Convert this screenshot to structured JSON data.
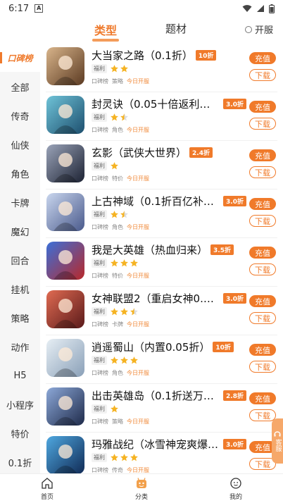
{
  "status_bar": {
    "time": "6:17",
    "sim_label": "A"
  },
  "top_tabs": [
    {
      "label": "类型",
      "active": true
    },
    {
      "label": "题材",
      "active": false
    }
  ],
  "kaifu_toggle": {
    "label": "开服"
  },
  "sidebar": {
    "items": [
      {
        "label": "口碑榜",
        "active": true
      },
      {
        "label": "全部"
      },
      {
        "label": "传奇"
      },
      {
        "label": "仙侠"
      },
      {
        "label": "角色"
      },
      {
        "label": "卡牌"
      },
      {
        "label": "魔幻"
      },
      {
        "label": "回合"
      },
      {
        "label": "挂机"
      },
      {
        "label": "策略"
      },
      {
        "label": "动作"
      },
      {
        "label": "H5"
      },
      {
        "label": "小程序"
      },
      {
        "label": "特价"
      },
      {
        "label": "0.1折"
      }
    ]
  },
  "games": [
    {
      "name": "大当家之路（0.1折）",
      "discount": "10折",
      "fuli": "福利",
      "rating": 2,
      "tags": [
        "口碑榜",
        "策略"
      ],
      "open": "今日开服",
      "icon_colors": [
        "#d8b48a",
        "#5b3a22"
      ]
    },
    {
      "name": "封灵诀（0.05十倍返利免单…",
      "discount": "3.0折",
      "fuli": "福利",
      "rating": 1.5,
      "tags": [
        "口碑榜",
        "角色"
      ],
      "open": "今日开服",
      "icon_colors": [
        "#6fc3d8",
        "#1d4f6e"
      ]
    },
    {
      "name": "玄影（武侠大世界）",
      "discount": "2.4折",
      "fuli": "福利",
      "rating": 1,
      "tags": [
        "口碑榜",
        "特价"
      ],
      "open": "今日开服",
      "icon_colors": [
        "#9aa3b8",
        "#1c2233"
      ]
    },
    {
      "name": "上古神域（0.1折百亿补贴）",
      "discount": "3.0折",
      "fuli": "福利",
      "rating": 1.5,
      "tags": [
        "口碑榜",
        "角色"
      ],
      "open": "今日开服",
      "icon_colors": [
        "#c9d6ee",
        "#4a5a8c"
      ]
    },
    {
      "name": "我是大英雄（热血归来）",
      "discount": "3.5折",
      "fuli": "福利",
      "rating": 3,
      "tags": [
        "口碑榜",
        "特价"
      ],
      "open": "今日开服",
      "icon_colors": [
        "#3b6fd8",
        "#b8282a"
      ]
    },
    {
      "name": "女神联盟2（重启女神0.05…",
      "discount": "3.0折",
      "fuli": "福利",
      "rating": 2.5,
      "tags": [
        "口碑榜",
        "卡牌"
      ],
      "open": "今日开服",
      "icon_colors": [
        "#e06b52",
        "#5a1a1a"
      ]
    },
    {
      "name": "逍遥蜀山（内置0.05折）",
      "discount": "10折",
      "fuli": "福利",
      "rating": 3,
      "tags": [
        "口碑榜",
        "角色"
      ],
      "open": "今日开服",
      "icon_colors": [
        "#e6eef4",
        "#8aa0b8"
      ]
    },
    {
      "name": "出击英雄岛（0.1折送万充）",
      "discount": "2.8折",
      "fuli": "福利",
      "rating": 1,
      "tags": [
        "口碑榜",
        "策略"
      ],
      "open": "今日开服",
      "icon_colors": [
        "#8ca8d8",
        "#1e2a4a"
      ]
    },
    {
      "name": "玛雅战纪（冰雪神宠爽爆充…",
      "discount": "3.0折",
      "fuli": "福利",
      "rating": 3,
      "tags": [
        "口碑榜",
        "传奇"
      ],
      "open": "今日开服",
      "icon_colors": [
        "#4fa8e0",
        "#102a55"
      ]
    }
  ],
  "buttons": {
    "charge": "充值",
    "download": "下载"
  },
  "float_service": {
    "label": "客服"
  },
  "bottom_nav": [
    {
      "label": "首页",
      "icon": "home-icon"
    },
    {
      "label": "分类",
      "icon": "category-icon"
    },
    {
      "label": "我的",
      "icon": "profile-icon"
    }
  ],
  "colors": {
    "accent": "#f07a2a",
    "star": "#f5b323"
  }
}
